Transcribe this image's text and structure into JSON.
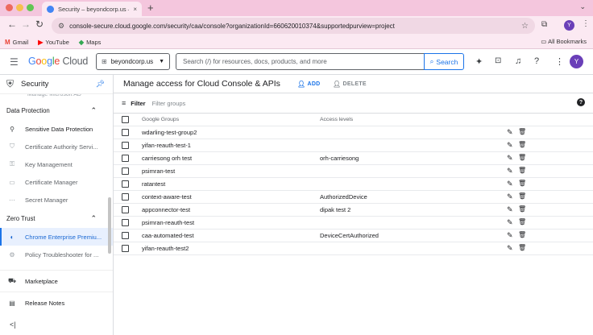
{
  "browser": {
    "tab_title": "Security – beyondcorp.us – G",
    "tab_close": "×",
    "new_tab": "+",
    "tab_menu": "⌄",
    "url": "console-secure.cloud.google.com/security/caa/console?organizationId=660620010374&supportedpurview=project",
    "profile_initial": "Y",
    "bookmarks": [
      {
        "label": "Gmail",
        "icon": "gmail-icon",
        "glyph": "M",
        "color": "#ea4335"
      },
      {
        "label": "YouTube",
        "icon": "youtube-icon",
        "glyph": "▶",
        "color": "#ff0000"
      },
      {
        "label": "Maps",
        "icon": "maps-icon",
        "glyph": "◆",
        "color": "#34a853"
      }
    ],
    "all_bookmarks": "All Bookmarks"
  },
  "header": {
    "logo_google": "Google",
    "logo_cloud": "Cloud",
    "project": "beyondcorp.us",
    "search_placeholder": "Search (/) for resources, docs, products, and more",
    "search_button": "Search",
    "avatar_initial": "Y"
  },
  "sidebar": {
    "title": "Security",
    "cut_item": "Manage Microsoft AD",
    "sections": [
      {
        "label": "Data Protection",
        "items": [
          {
            "label": "Sensitive Data Protection",
            "icon": "sensitive-data-icon",
            "glyph": "⚲",
            "style": "dark"
          },
          {
            "label": "Certificate Authority Servi...",
            "icon": "certificate-authority-icon",
            "glyph": "⛉",
            "style": ""
          },
          {
            "label": "Key Management",
            "icon": "key-icon",
            "glyph": "⚿",
            "style": ""
          },
          {
            "label": "Certificate Manager",
            "icon": "certificate-icon",
            "glyph": "▭",
            "style": ""
          },
          {
            "label": "Secret Manager",
            "icon": "secret-icon",
            "glyph": "⋯",
            "style": ""
          }
        ]
      },
      {
        "label": "Zero Trust",
        "items": [
          {
            "label": "Chrome Enterprise Premiu...",
            "icon": "chrome-enterprise-icon",
            "glyph": "◐",
            "style": "active"
          },
          {
            "label": "Policy Troubleshooter for ...",
            "icon": "policy-troubleshooter-icon",
            "glyph": "⚙",
            "style": ""
          }
        ]
      }
    ],
    "bottom": [
      {
        "label": "Marketplace",
        "icon": "marketplace-icon",
        "glyph": "⛟"
      },
      {
        "label": "Release Notes",
        "icon": "release-notes-icon",
        "glyph": "▤"
      }
    ],
    "collapse": "<|"
  },
  "main": {
    "title": "Manage access for Cloud Console & APIs",
    "add_label": "ADD",
    "delete_label": "DELETE",
    "filter_label": "Filter",
    "filter_placeholder": "Filter groups",
    "columns": {
      "group": "Google Groups",
      "level": "Access levels"
    },
    "rows": [
      {
        "group": "wdarling-test-group2",
        "level": ""
      },
      {
        "group": "yifan-reauth-test-1",
        "level": ""
      },
      {
        "group": "carriesong orh test",
        "level": "orh-carriesong"
      },
      {
        "group": "psimran-test",
        "level": ""
      },
      {
        "group": "ratantest",
        "level": ""
      },
      {
        "group": "context-aware-test",
        "level": "AuthorizedDevice"
      },
      {
        "group": "appconnector-test",
        "level": "dipak test 2"
      },
      {
        "group": "psimran-reauth-test",
        "level": ""
      },
      {
        "group": "caa-automated-test",
        "level": "DeviceCertAuthorized"
      },
      {
        "group": "yifan-reauth-test2",
        "level": ""
      }
    ]
  }
}
